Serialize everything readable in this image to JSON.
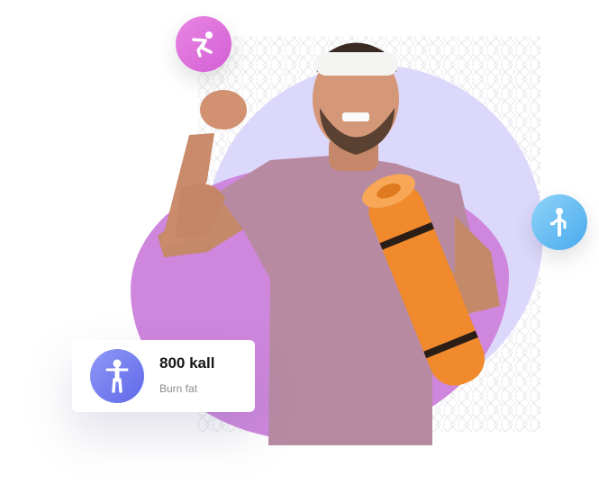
{
  "stat_card": {
    "value": "800 kall",
    "label": "Burn fat",
    "icon": "standing-person-icon"
  },
  "badges": [
    {
      "icon": "kicking-person-icon",
      "color": "#e27ae0"
    },
    {
      "icon": "person-exercise-icon",
      "color": "#5db6f1"
    }
  ],
  "colors": {
    "lavender_circle": "#dcd8fb",
    "pink_blob": "#cf86dd",
    "stat_icon": "#6f78ef"
  }
}
